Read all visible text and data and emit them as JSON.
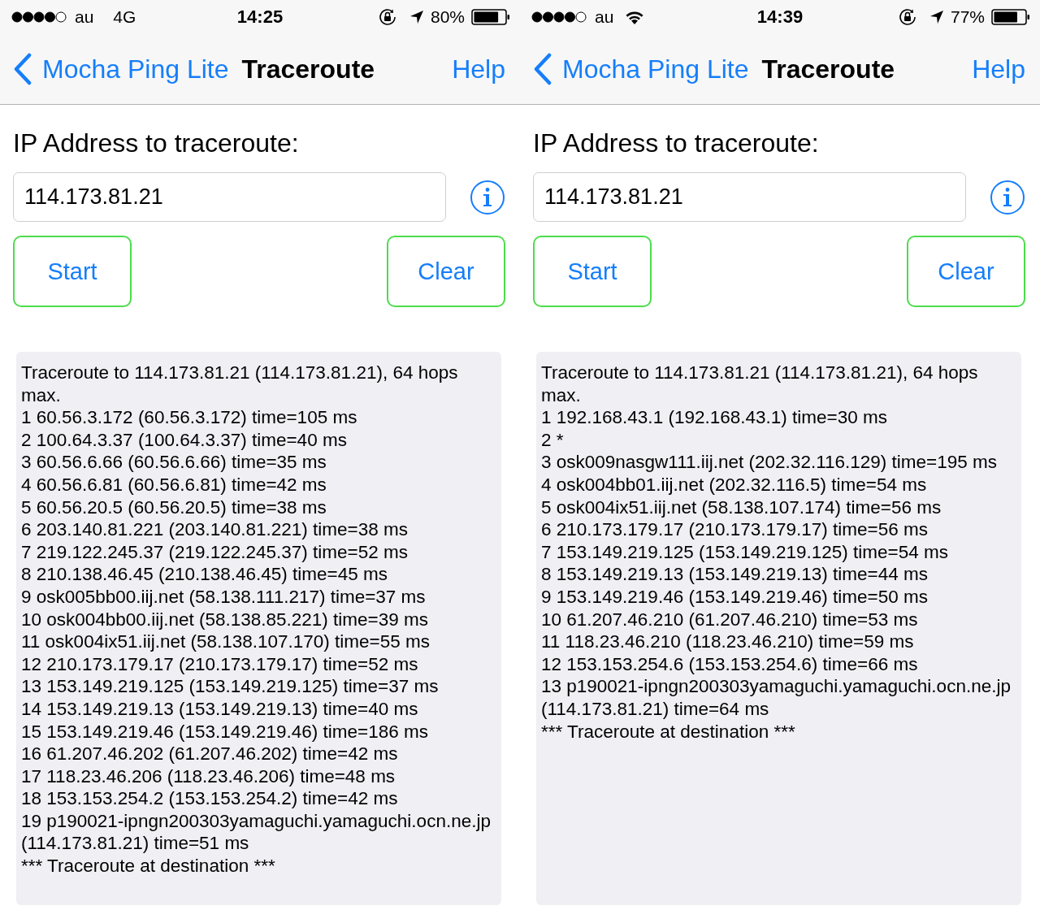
{
  "screens": [
    {
      "status_bar": {
        "carrier": "au",
        "network": {
          "kind": "cellular",
          "label": "4G"
        },
        "time": "14:25",
        "battery": "80%"
      },
      "nav_bar": {
        "back": "Mocha Ping Lite",
        "title": "Traceroute",
        "action": "Help"
      },
      "address_label": "IP Address to traceroute:",
      "address_field": {
        "value": "114.173.81.21"
      },
      "buttons": [
        "Start",
        "Clear"
      ],
      "output": [
        "Traceroute to 114.173.81.21 (114.173.81.21), 64 hops max.",
        "1 60.56.3.172 (60.56.3.172) time=105 ms",
        "2 100.64.3.37 (100.64.3.37) time=40 ms",
        "3 60.56.6.66 (60.56.6.66) time=35 ms",
        "4 60.56.6.81 (60.56.6.81) time=42 ms",
        "5 60.56.20.5 (60.56.20.5) time=38 ms",
        "6 203.140.81.221 (203.140.81.221) time=38 ms",
        "7 219.122.245.37 (219.122.245.37) time=52 ms",
        "8 210.138.46.45 (210.138.46.45) time=45 ms",
        "9 osk005bb00.iij.net (58.138.111.217) time=37 ms",
        "10 osk004bb00.iij.net (58.138.85.221) time=39 ms",
        "11 osk004ix51.iij.net (58.138.107.170) time=55 ms",
        "12 210.173.179.17 (210.173.179.17) time=52 ms",
        "13 153.149.219.125 (153.149.219.125) time=37 ms",
        "14 153.149.219.13 (153.149.219.13) time=40 ms",
        "15 153.149.219.46 (153.149.219.46) time=186 ms",
        "16 61.207.46.202 (61.207.46.202) time=42 ms",
        "17 118.23.46.206 (118.23.46.206) time=48 ms",
        "18 153.153.254.2 (153.153.254.2) time=42 ms",
        "19 p190021-ipngn200303yamaguchi.yamaguchi.ocn.ne.jp (114.173.81.21) time=51 ms",
        "*** Traceroute at destination ***"
      ]
    },
    {
      "status_bar": {
        "carrier": "au",
        "network": {
          "kind": "wifi"
        },
        "time": "14:39",
        "battery": "77%"
      },
      "nav_bar": {
        "back": "Mocha Ping Lite",
        "title": "Traceroute",
        "action": "Help"
      },
      "address_label": "IP Address to traceroute:",
      "address_field": {
        "value": "114.173.81.21"
      },
      "buttons": [
        "Start",
        "Clear"
      ],
      "output": [
        "Traceroute to 114.173.81.21 (114.173.81.21), 64 hops max.",
        "1 192.168.43.1 (192.168.43.1) time=30 ms",
        "2 *",
        "3 osk009nasgw111.iij.net (202.32.116.129) time=195 ms",
        "4 osk004bb01.iij.net (202.32.116.5) time=54 ms",
        "5 osk004ix51.iij.net (58.138.107.174) time=56 ms",
        "6 210.173.179.17 (210.173.179.17) time=56 ms",
        "7 153.149.219.125 (153.149.219.125) time=54 ms",
        "8 153.149.219.13 (153.149.219.13) time=44 ms",
        "9 153.149.219.46 (153.149.219.46) time=50 ms",
        "10 61.207.46.210 (61.207.46.210) time=53 ms",
        "11 118.23.46.210 (118.23.46.210) time=59 ms",
        "12 153.153.254.6 (153.153.254.6) time=66 ms",
        "13 p190021-ipngn200303yamaguchi.yamaguchi.ocn.ne.jp (114.173.81.21) time=64 ms",
        "*** Traceroute at destination ***"
      ]
    }
  ]
}
